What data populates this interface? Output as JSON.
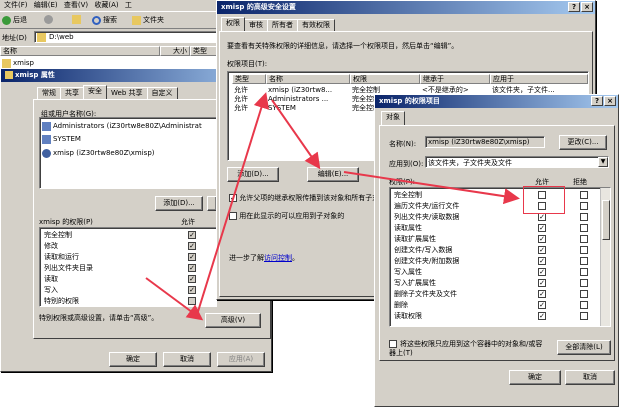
{
  "explorer": {
    "menu": [
      "文件(F)",
      "编辑(E)",
      "查看(V)",
      "收藏(A)",
      "工"
    ],
    "back_label": "后退",
    "search_label": "搜索",
    "folders_label": "文件夹",
    "address_label": "地址(D)",
    "address_value": "D:\\web",
    "col_name": "名称",
    "col_size": "大小",
    "col_type": "类型",
    "item": "xmisp"
  },
  "props": {
    "title": "xmisp 属性",
    "tabs": [
      "常规",
      "共享",
      "安全",
      "Web 共享",
      "自定义"
    ],
    "active_tab": "安全",
    "group_label": "组或用户名称(G):",
    "users": [
      "Administrators (iZ30rtw8e80Z\\Administrat",
      "SYSTEM",
      "xmisp (iZ30rtw8e80Z\\xmisp)"
    ],
    "add_button": "添加(D)...",
    "perm_title": "xmisp 的权限(P)",
    "perm_allow": "允许",
    "perms": [
      "完全控制",
      "修改",
      "读取和运行",
      "列出文件夹目录",
      "读取",
      "写入",
      "特别的权限"
    ],
    "perm_checks": [
      true,
      true,
      true,
      true,
      true,
      true,
      false
    ],
    "advanced_hint": "特别权限或高级设置，请单击“高级”。",
    "advanced_button": "高级(V)",
    "ok": "确定",
    "cancel": "取消",
    "apply": "应用(A)"
  },
  "adv": {
    "title": "xmisp 的高级安全设置",
    "tabs": [
      "权限",
      "审核",
      "所有者",
      "有效权限"
    ],
    "intro": "要查看有关特殊权限的详细信息，请选择一个权限项目，然后单击“编辑”。",
    "entries_label": "权限项目(T):",
    "cols": [
      "类型",
      "名称",
      "权限",
      "继承于",
      "应用于"
    ],
    "rows": [
      [
        "允许",
        "xmisp (iZ30rtw8...",
        "完全控制",
        "<不是继承的>",
        "该文件夹，子文件..."
      ],
      [
        "允许",
        "Administrators ...",
        "完全控制",
        "",
        ""
      ],
      [
        "允许",
        "SYSTEM",
        "完全控制",
        "",
        ""
      ]
    ],
    "add_button": "添加(D)...",
    "edit_button": "编辑(E)...",
    "inherit_text": "允许父项的继承权限传播到该对象和所有子对象",
    "replace_text": "用在此显示的可以应用到子对象的",
    "learn_prefix": "进一步了解",
    "learn_link": "访问控制",
    "learn_suffix": "。"
  },
  "entry": {
    "title": "xmisp 的权限项目",
    "tab": "对象",
    "name_label": "名称(N):",
    "name_value": "xmisp (iZ30rtw8e80Z\\xmisp)",
    "change_button": "更改(C)...",
    "apply_label": "应用到(O):",
    "apply_value": "该文件夹，子文件夹及文件",
    "perm_label": "权限(P):",
    "allow": "允许",
    "deny": "拒绝",
    "perms": [
      "完全控制",
      "遍历文件夹/运行文件",
      "列出文件夹/读取数据",
      "读取属性",
      "读取扩展属性",
      "创建文件/写入数据",
      "创建文件夹/附加数据",
      "写入属性",
      "写入扩展属性",
      "删除子文件夹及文件",
      "删除",
      "读取权限"
    ],
    "allow_checks": [
      false,
      false,
      true,
      true,
      true,
      true,
      true,
      true,
      true,
      true,
      true,
      true
    ],
    "deny_checks": [
      false,
      false,
      false,
      false,
      false,
      false,
      false,
      false,
      false,
      false,
      false,
      false
    ],
    "apply_only_text": "将这些权限只应用到这个容器中的对象和/或容器上(T)",
    "clear_all": "全部清除(L)",
    "ok": "确定",
    "cancel": "取消"
  },
  "colors": {
    "arrow": "#e8384b",
    "title_dark": "#0a246a",
    "title_light": "#a6caf0",
    "highlight": "#e8384b"
  }
}
